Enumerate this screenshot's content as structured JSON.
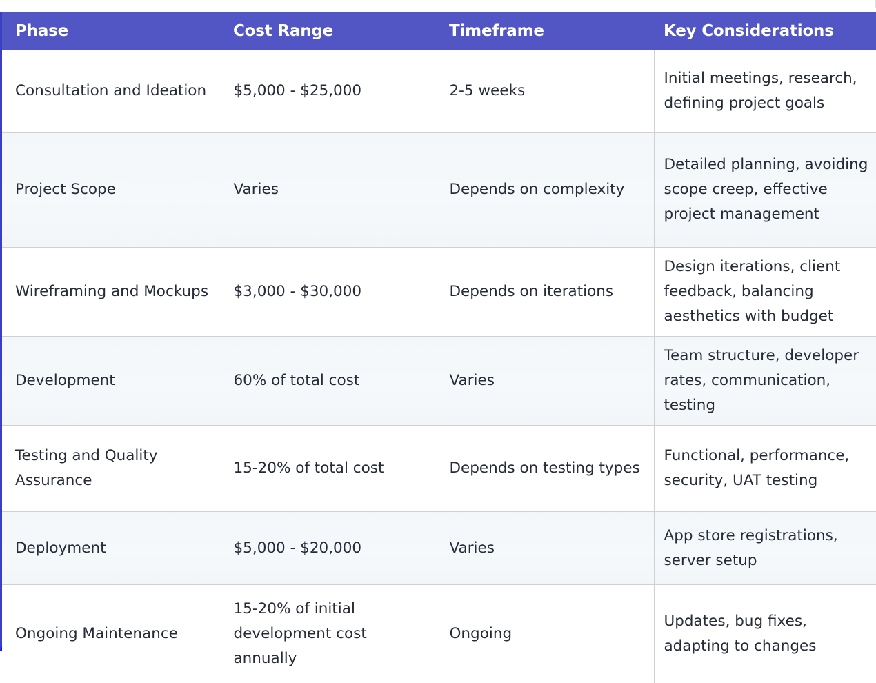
{
  "table": {
    "accent_header_bg": "#5156c4",
    "accent_header_text": "#ffffff",
    "accent_side_border": "#3b3fc4",
    "accent_bottom_border": "#1414f0",
    "alt_row_bg": "#f4f8fa",
    "row_bg": "#ffffff",
    "grid_line": "#cfcfd4",
    "body_text": "#262b38",
    "columns": [
      {
        "key": "phase",
        "label": "Phase"
      },
      {
        "key": "cost_range",
        "label": "Cost Range"
      },
      {
        "key": "timeframe",
        "label": "Timeframe"
      },
      {
        "key": "key_considerations",
        "label": "Key Considerations"
      }
    ],
    "rows": [
      {
        "phase": "Consultation and Ideation",
        "cost_range": "$5,000 - $25,000",
        "timeframe": "2-5 weeks",
        "key_considerations": "Initial meetings, research, defining project goals"
      },
      {
        "phase": "Project Scope",
        "cost_range": "Varies",
        "timeframe": "Depends on complexity",
        "key_considerations": "Detailed planning, avoiding scope creep, effective project management"
      },
      {
        "phase": "Wireframing and Mockups",
        "cost_range": "$3,000 - $30,000",
        "timeframe": "Depends on iterations",
        "key_considerations": "Design iterations, client feedback, balancing aesthetics with budget"
      },
      {
        "phase": "Development",
        "cost_range": "60% of total cost",
        "timeframe": "Varies",
        "key_considerations": "Team structure, developer rates, communication, testing"
      },
      {
        "phase": "Testing and Quality Assurance",
        "cost_range": "15-20% of total cost",
        "timeframe": "Depends on testing types",
        "key_considerations": "Functional, performance, security, UAT testing"
      },
      {
        "phase": "Deployment",
        "cost_range": "$5,000 - $20,000",
        "timeframe": "Varies",
        "key_considerations": "App store registrations, server setup"
      },
      {
        "phase": "Ongoing Maintenance",
        "cost_range": "15-20% of initial development cost annually",
        "timeframe": "Ongoing",
        "key_considerations": "Updates, bug fixes, adapting to changes"
      }
    ]
  }
}
